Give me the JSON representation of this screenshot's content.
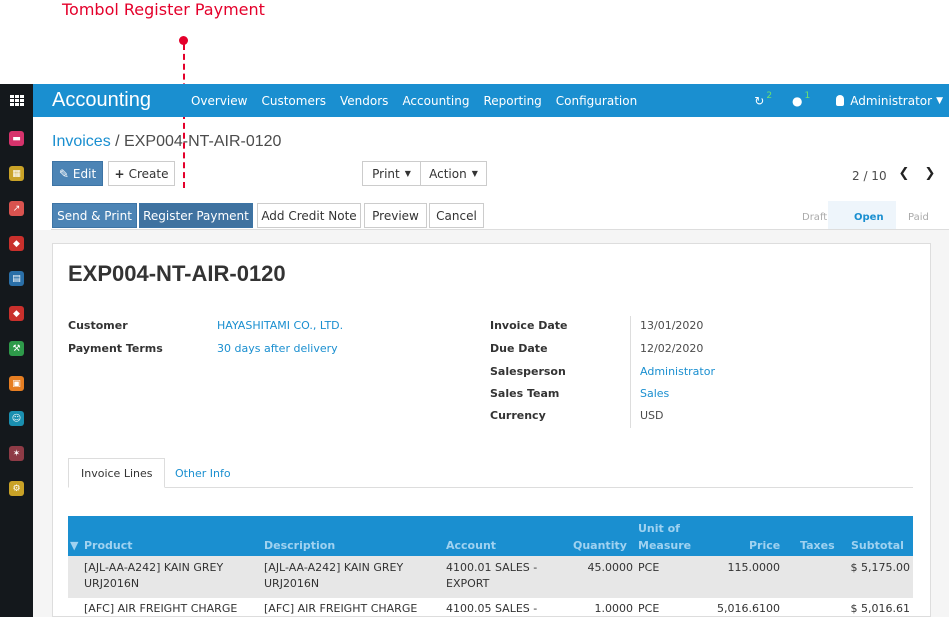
{
  "annotation": {
    "label": "Tombol Register Payment"
  },
  "topbar": {
    "app_title": "Accounting",
    "menu": [
      "Overview",
      "Customers",
      "Vendors",
      "Accounting",
      "Reporting",
      "Configuration"
    ],
    "activity_count": "2",
    "message_count": "1",
    "user": "Administrator"
  },
  "breadcrumb": {
    "parent": "Invoices",
    "separator": " / ",
    "current": "EXP004-NT-AIR-0120"
  },
  "control": {
    "edit": "Edit",
    "create": "Create",
    "print": "Print",
    "action": "Action",
    "pager": "2 / 10"
  },
  "actions": {
    "send_print": "Send & Print",
    "register_payment": "Register Payment",
    "add_credit_note": "Add Credit Note",
    "preview": "Preview",
    "cancel": "Cancel"
  },
  "status": {
    "draft": "Draft",
    "open": "Open",
    "paid": "Paid"
  },
  "invoice": {
    "title": "EXP004-NT-AIR-0120",
    "customer_label": "Customer",
    "customer": "HAYASHITAMI CO., LTD.",
    "payment_terms_label": "Payment Terms",
    "payment_terms": "30 days after delivery",
    "invoice_date_label": "Invoice Date",
    "invoice_date": "13/01/2020",
    "due_date_label": "Due Date",
    "due_date": "12/02/2020",
    "salesperson_label": "Salesperson",
    "salesperson": "Administrator",
    "sales_team_label": "Sales Team",
    "sales_team": "Sales",
    "currency_label": "Currency",
    "currency": "USD"
  },
  "tabs": {
    "invoice_lines": "Invoice Lines",
    "other_info": "Other Info"
  },
  "table": {
    "headers": {
      "product": "Product",
      "description": "Description",
      "account": "Account",
      "quantity": "Quantity",
      "uom_line1": "Unit of",
      "uom_line2": "Measure",
      "price": "Price",
      "taxes": "Taxes",
      "subtotal": "Subtotal"
    },
    "rows": [
      {
        "product_1": "[AJL-AA-A242] KAIN GREY",
        "product_2": "URJ2016N",
        "description_1": "[AJL-AA-A242] KAIN GREY",
        "description_2": "URJ2016N",
        "account_1": "4100.01 SALES -",
        "account_2": "EXPORT",
        "quantity": "45.0000",
        "uom": "PCE",
        "price": "115.0000",
        "subtotal": "$ 5,175.00"
      },
      {
        "product_1": "[AFC] AIR FREIGHT CHARGE",
        "product_2": "",
        "description_1": "[AFC] AIR FREIGHT CHARGE",
        "description_2": "",
        "account_1": "4100.05 SALES -",
        "account_2": "",
        "quantity": "1.0000",
        "uom": "PCE",
        "price": "5,016.6100",
        "subtotal": "$ 5,016.61"
      }
    ]
  }
}
